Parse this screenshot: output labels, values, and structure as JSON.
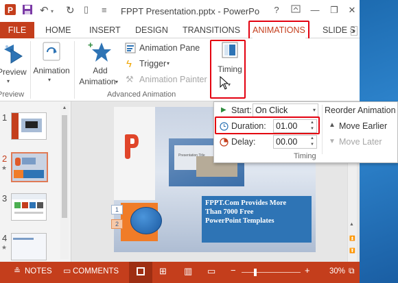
{
  "titlebar": {
    "title": "FPPT Presentation.pptx - PowerPo",
    "help": "?",
    "minimize": "—",
    "restore": "❐"
  },
  "tabs": [
    {
      "label": "FILE"
    },
    {
      "label": "HOME"
    },
    {
      "label": "INSERT"
    },
    {
      "label": "DESIGN"
    },
    {
      "label": "TRANSITIONS"
    },
    {
      "label": "ANIMATIONS"
    },
    {
      "label": "SLIDE S"
    }
  ],
  "ribbon": {
    "preview_label": "Preview",
    "preview_group": "Preview",
    "animation_label": "Animation",
    "add_animation_line1": "Add",
    "add_animation_line2": "Animation",
    "animation_pane": "Animation Pane",
    "trigger": "Trigger",
    "animation_painter": "Animation Painter",
    "advanced_group": "Advanced Animation",
    "timing_label": "Timing"
  },
  "timing_popup": {
    "start_label": "Start:",
    "start_value": "On Click",
    "duration_label": "Duration:",
    "duration_value": "01.00",
    "delay_label": "Delay:",
    "delay_value": "00.00",
    "reorder_title": "Reorder Animation",
    "move_earlier": "Move Earlier",
    "move_later": "Move Later",
    "group_label": "Timing"
  },
  "thumbnails": [
    {
      "number": "1"
    },
    {
      "number": "2"
    },
    {
      "number": "3"
    },
    {
      "number": "4"
    }
  ],
  "slide": {
    "headline_line1": "FPPT.Com Provides More",
    "headline_line2": "Than 7000 Free",
    "headline_line3": "PowerPoint Templates",
    "tag1": "1",
    "tag2": "2",
    "inner_title": "Presentation Title"
  },
  "statusbar": {
    "notes": "NOTES",
    "comments": "COMMENTS",
    "zoom": "30%"
  },
  "colors": {
    "accent": "#c43e1c",
    "highlight_box": "#e3000f",
    "slide_blue": "#2e74b5"
  }
}
